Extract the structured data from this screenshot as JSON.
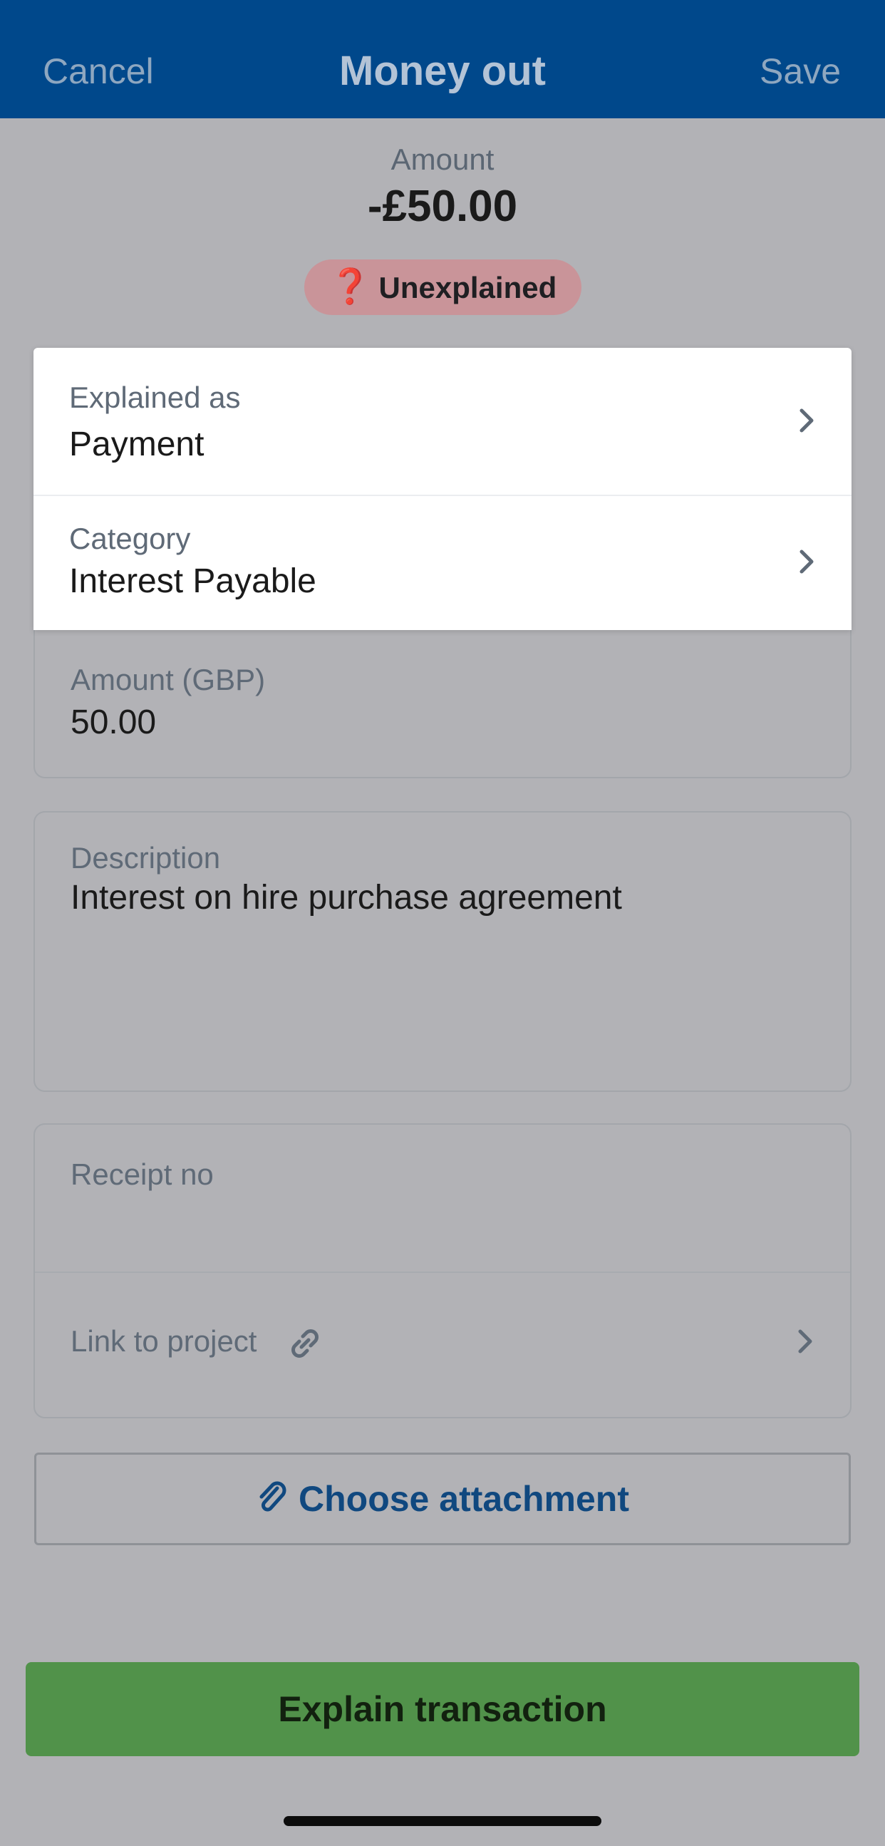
{
  "header": {
    "cancel_label": "Cancel",
    "title": "Money out",
    "save_label": "Save"
  },
  "summary": {
    "amount_label": "Amount",
    "amount_value": "-£50.00",
    "status_icon": "question-icon",
    "status_label": "Unexplained"
  },
  "form": {
    "explained_as": {
      "label": "Explained as",
      "value": "Payment"
    },
    "category": {
      "label": "Category",
      "value": "Interest Payable"
    },
    "amount_gbp": {
      "label": "Amount (GBP)",
      "value": "50.00"
    },
    "description": {
      "label": "Description",
      "value": "Interest on hire purchase agreement"
    },
    "receipt_no": {
      "label": "Receipt no",
      "value": ""
    },
    "link_to_project": {
      "label": "Link to project",
      "icon": "link-icon"
    }
  },
  "actions": {
    "attachment_label": "Choose attachment",
    "attachment_icon": "paperclip-icon",
    "explain_label": "Explain transaction"
  },
  "colors": {
    "header_bg": "#00488b",
    "overlay_bg": "#b2b2b6",
    "badge_bg": "#c99499",
    "accent_blue": "#10487f",
    "primary_green": "#51924a"
  }
}
